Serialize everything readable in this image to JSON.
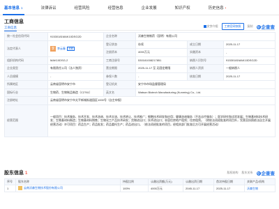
{
  "tabs": [
    {
      "label": "基本信息",
      "count": "1",
      "active": true
    },
    {
      "label": "法律诉讼",
      "count": ""
    },
    {
      "label": "经营风险",
      "count": ""
    },
    {
      "label": "经营信息",
      "count": ""
    },
    {
      "label": "企业发展",
      "count": ""
    },
    {
      "label": "知识产权",
      "count": ""
    },
    {
      "label": "历史信息",
      "count": "",
      "hot": "•"
    }
  ],
  "section_title": "工商信息",
  "sub_tab": "工商信息",
  "toolbar": {
    "checkbox_label": "文字介绍",
    "view_button": "工商官网快照",
    "copy": "复制",
    "brand": "企查查"
  },
  "info": {
    "credit_code_label": "统一社会信用代码",
    "credit_code": "91530181MAK10DSG2D",
    "name_label": "企业名称",
    "name": "沃森生物制药（昆明）有限公司",
    "legal_label": "法定代表人",
    "legal_avatar": "李",
    "legal_name": "李云春",
    "legal_tag": "关联",
    "status_label": "登记状态",
    "status": "存续",
    "est_label": "成立日期",
    "est": "2025-11-17",
    "capital_label": "注册资本",
    "capital": "4000万元",
    "paid_label": "实缴资本",
    "paid": "-",
    "org_label": "组织机构代码",
    "org": "MAK10DSG-2",
    "reg_no_label": "工商注册号",
    "reg_no": "530181008217851",
    "tax_label": "纳税人识别号",
    "tax": "91530181MAK10DSG2D",
    "type_label": "企业类型",
    "type": "有限责任公司（法人独资）",
    "term_label": "营业期限",
    "term": "2025-11-17 至 无固定期限",
    "taxpayer_label": "纳税人资质",
    "taxpayer": "一般纳税人",
    "staff_label": "人员规模",
    "staff": "-",
    "insured_label": "参保人数",
    "insured": "-",
    "approve_label": "核准日期",
    "approve": "2025-11-17",
    "region_label": "所属地区",
    "region": "云南省昆明市安宁市",
    "authority_label": "登记机关",
    "authority": "安宁市市场监督管理局",
    "industry_label": "国标行业",
    "industry": "生物药、生物制品制造（C2761）",
    "en_label": "英文名",
    "en": "Watson Biotech Manufacturing (Kunming) Co., Ltd.",
    "address_label": "注册地址",
    "address": "云南省昆明市安宁市太平新城街道园区1000号（自主申报）",
    "scope_label": "经营范围",
    "scope": "一般项目：技术服务、技术开发、技术咨询、技术交流、技术转让、技术推广；细胞技术研发和应用；健康咨询服务（不含诊疗服务）；医学研究和试验发展；生物基材料技术研发；生物基材料制造；生物基材料销售；生物化工产品技术研发；货物进出口；技术进出口；非居住房地产租赁；住房租赁。（除依法须经批准的项目外，凭营业执照依法自主开展经营活动）许可项目：药品生产；药品批发；药品委托生产；药品进出口。（依法须经批准的项目，经相关部门批准后方可开展经营活动）"
  },
  "branch": {
    "title": "股东信息",
    "count": "1",
    "tools": [
      "股权结构",
      "股东关系",
      "企查查"
    ],
    "headers": [
      "序号",
      "股东名称",
      "持股比例",
      "认缴出资额(万元)",
      "认缴出资日期",
      "首次持股日期",
      "关联产品/机构"
    ],
    "rows": [
      [
        "1",
        "云南沃森生物技术股份有限公司",
        "100%",
        "4000万元",
        "2045-11-17",
        "2025-11-17",
        "沃森生物"
      ]
    ]
  }
}
